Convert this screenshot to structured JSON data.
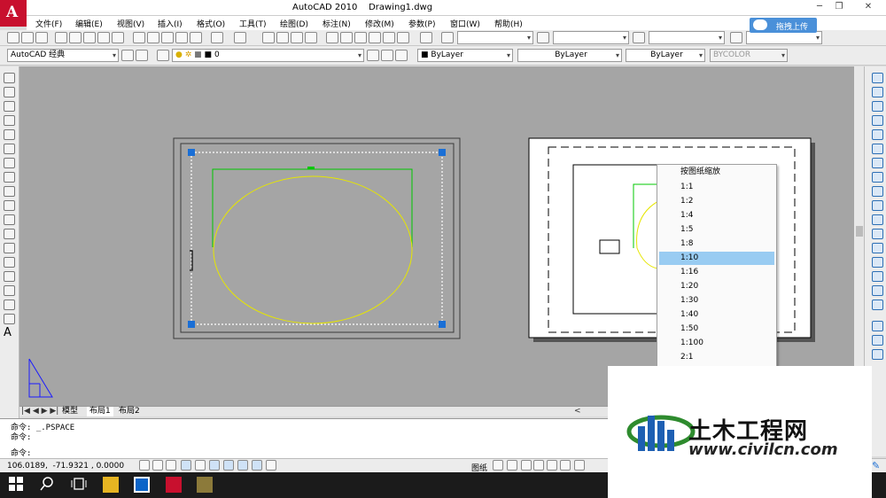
{
  "window": {
    "app_logo_letter": "A",
    "title": "AutoCAD 2010    Drawing1.dwg",
    "minimize": "─",
    "restore": "❐",
    "close": "✕"
  },
  "menu": [
    "文件(F)",
    "编辑(E)",
    "视图(V)",
    "插入(I)",
    "格式(O)",
    "工具(T)",
    "绘图(D)",
    "标注(N)",
    "修改(M)",
    "参数(P)",
    "窗口(W)",
    "帮助(H)"
  ],
  "upload_button": "拖拽上传",
  "workspace": {
    "value": "AutoCAD 经典"
  },
  "layer_combo": {
    "value": "0"
  },
  "color_combo": {
    "value": "ByLayer"
  },
  "linetype_combo": {
    "value": "ByLayer"
  },
  "lineweight_combo": {
    "value": "ByLayer"
  },
  "plotstyle_combo": {
    "value": "BYCOLOR"
  },
  "layout_tabs": [
    "模型",
    "布局1",
    "布局2"
  ],
  "command_lines": [
    "命令: _.PSPACE",
    "命令:",
    "命令:"
  ],
  "status": {
    "coords": "106.0189,  -71.9321 , 0.0000",
    "paper_label": "图纸"
  },
  "scale_menu": {
    "title": "按图纸缩放",
    "items": [
      "1:1",
      "1:2",
      "1:4",
      "1:5",
      "1:8",
      "1:10",
      "1:16",
      "1:20",
      "1:30",
      "1:40",
      "1:50",
      "1:100",
      "2:1"
    ],
    "selected": "1:10"
  },
  "watermark": {
    "name": "土木工程网",
    "url": "www.civilcn.com"
  },
  "colors": {
    "canvas": "#a5a5a5",
    "viewport_green": "#00c800",
    "ellipse_yellow": "#e6e600",
    "grip_blue": "#1a6fd6",
    "selected_menu": "#99ccf2"
  }
}
